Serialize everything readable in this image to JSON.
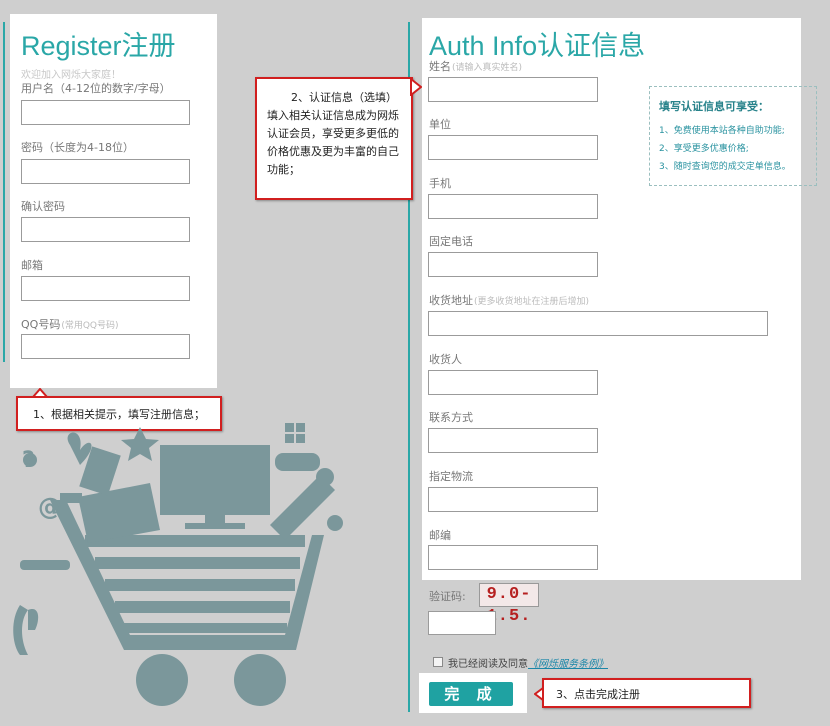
{
  "colors": {
    "accent": "#2aa7a7",
    "callout_border": "#d11f1f",
    "captcha_text": "#b62020"
  },
  "register": {
    "title": "Register注册",
    "welcome": "欢迎加入网烁大家庭！",
    "fields": {
      "username": "用户名（4-12位的数字/字母）",
      "password": "密码（长度为4-18位）",
      "confirm": "确认密码",
      "email": "邮箱",
      "qq": "QQ号码",
      "qq_hint": "(常用QQ号码)"
    }
  },
  "auth": {
    "title": "Auth Info认证信息",
    "fields": {
      "name": "姓名",
      "name_hint": "(请输入真实姓名)",
      "company": "单位",
      "mobile": "手机",
      "phone": "固定电话",
      "address": "收货地址",
      "address_hint": "(更多收货地址在注册后增加)",
      "receiver": "收货人",
      "contact": "联系方式",
      "logistics": "指定物流",
      "postcode": "邮编"
    }
  },
  "benefits": {
    "title": "填写认证信息可享受：",
    "items": [
      "1、免费使用本站各种自助功能;",
      "2、享受更多优惠价格;",
      "3、随时查询您的成交定单信息。"
    ]
  },
  "callouts": {
    "c1": "1、根据相关提示，填写注册信息；",
    "c2_title": "2、认证信息（选填）",
    "c2_body": "填入相关认证信息成为网烁认证会员，享受更多更低的价格优惠及更为丰富的自己功能；",
    "c3": "3、点击完成注册"
  },
  "captcha": {
    "label": "验证码:",
    "code": "9.0-1.5."
  },
  "agreement": {
    "text": "我已经阅读及同意",
    "link": "《网烁服务条例》"
  },
  "submit_label": "完 成"
}
